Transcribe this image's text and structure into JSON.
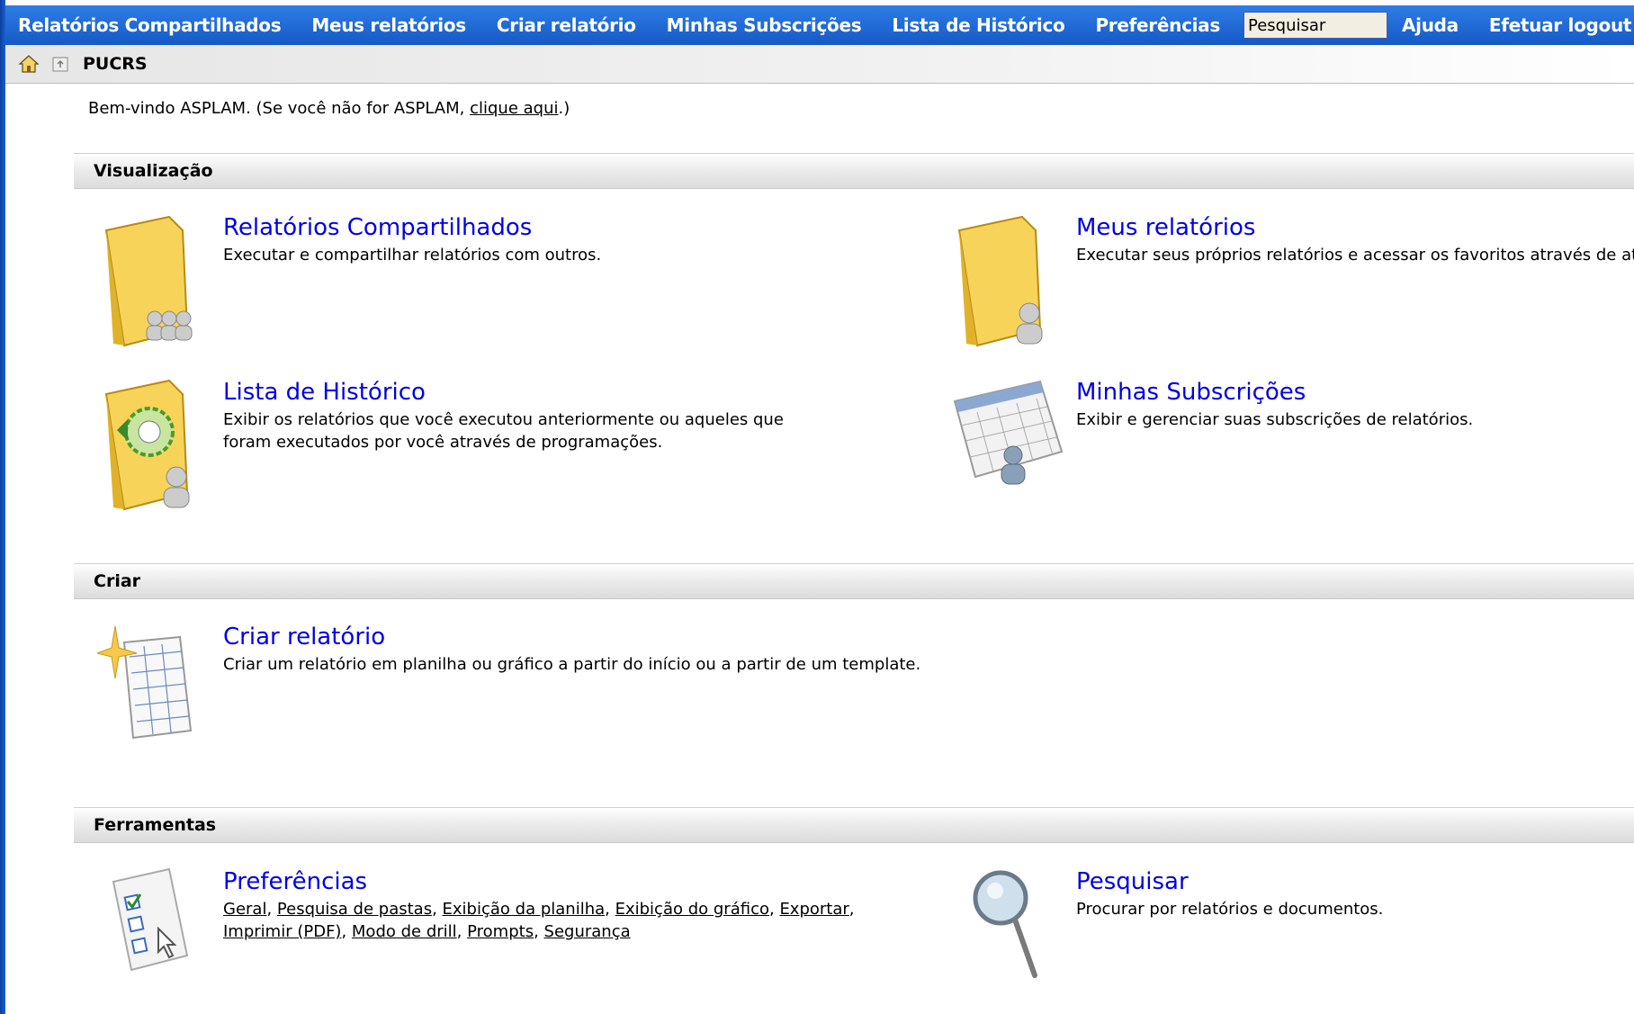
{
  "nav": {
    "items": [
      "Relatórios Compartilhados",
      "Meus relatórios",
      "Criar relatório",
      "Minhas Subscrições",
      "Lista de Histórico",
      "Preferências"
    ],
    "search_value": "Pesquisar",
    "help": "Ajuda",
    "logout": "Efetuar logout"
  },
  "breadcrumb": {
    "text": "PUCRS"
  },
  "welcome": {
    "prefix": "Bem-vindo ASPLAM. (Se você não for ASPLAM, ",
    "link": "clique aqui",
    "suffix": ".)"
  },
  "sections": {
    "view": "Visualização",
    "create": "Criar",
    "tools": "Ferramentas"
  },
  "items": {
    "shared": {
      "title": "Relatórios Compartilhados",
      "desc": "Executar e compartilhar relatórios com outros."
    },
    "mine": {
      "title": "Meus relatórios",
      "desc": "Executar seus próprios relatórios e acessar os favoritos através de atalhos."
    },
    "history": {
      "title": "Lista de Histórico",
      "desc": "Exibir os relatórios que você executou anteriormente ou aqueles que foram executados por você através de programações."
    },
    "subs": {
      "title": "Minhas Subscrições",
      "desc": "Exibir e gerenciar suas subscrições de relatórios."
    },
    "create": {
      "title": "Criar relatório",
      "desc": "Criar um relatório em planilha ou gráfico a partir do início ou a partir de um template."
    },
    "prefs": {
      "title": "Preferências",
      "links": [
        "Geral",
        "Pesquisa de pastas",
        "Exibição da planilha",
        "Exibição do gráfico",
        "Exportar",
        "Imprimir (PDF)",
        "Modo de drill",
        "Prompts",
        "Segurança"
      ]
    },
    "search": {
      "title": "Pesquisar",
      "desc": "Procurar por relatórios e documentos."
    }
  }
}
